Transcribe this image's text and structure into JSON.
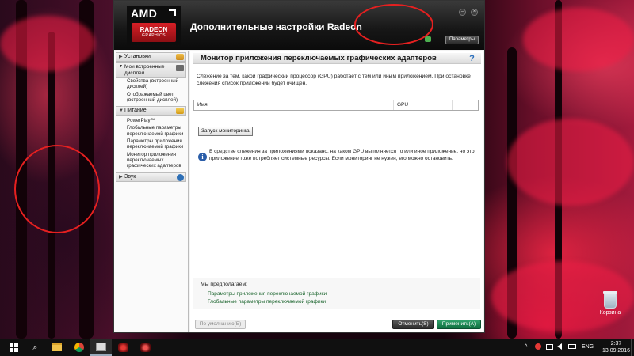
{
  "window": {
    "title": "Дополнительные настройки Radeon",
    "logo": {
      "brand": "AMD",
      "product": "RADEON",
      "sub": "GRAPHICS"
    },
    "params_button": "Параметры",
    "minimize_glyph": "–",
    "close_glyph": "×"
  },
  "sidebar": {
    "sections": [
      {
        "label": "Установки",
        "arrow": "▶"
      },
      {
        "label": "Мои встроенные дисплеи",
        "arrow": "▼",
        "items": [
          "Свойства (встроенный дисплей)",
          "Отображаемый цвет (встроенный дисплей)"
        ]
      },
      {
        "label": "Питание",
        "arrow": "▼",
        "items": [
          "PowerPlay™",
          "Глобальные параметры переключаемой графики",
          "Параметры приложения переключаемой графики",
          "Монитор приложения переключаемых графических адаптеров"
        ]
      },
      {
        "label": "Звук",
        "arrow": "▶"
      }
    ]
  },
  "content": {
    "header": "Монитор приложения переключаемых графических адаптеров",
    "help": "?",
    "description": "Слежение за тем, какой графический процессор (GPU) работает с тем или иным приложением. При остановке слежения список приложений будет очищен.",
    "table": {
      "columns": [
        "Имя",
        "GPU"
      ]
    },
    "start_button": "Запуск мониторинга",
    "info_glyph": "i",
    "info_text": "В средстве слежения за приложениями показано, на каком GPU выполняется то или иное приложение, но это приложение тоже потребляет системные ресурсы. Если мониторинг не нужен, его можно остановить.",
    "suggest": {
      "title": "Мы предполагаем:",
      "links": [
        "Параметры приложения переключаемой графики",
        "Глобальные параметры переключаемой графики"
      ]
    }
  },
  "footer": {
    "default_button": "По умолчанию(E)",
    "cancel_button": "Отменить(S)",
    "apply_button": "Применить(A)"
  },
  "desktop": {
    "recycle_bin": "Корзина"
  },
  "taskbar": {
    "search_glyph": "⌕",
    "tray_up": "^",
    "language": "ENG",
    "time": "2:37",
    "date": "13.09.2016"
  },
  "colors": {
    "accent_green": "#17622a",
    "apply_green": "#0f6e3f",
    "amd_red": "#d51f26",
    "annotation_red": "#e52020"
  }
}
